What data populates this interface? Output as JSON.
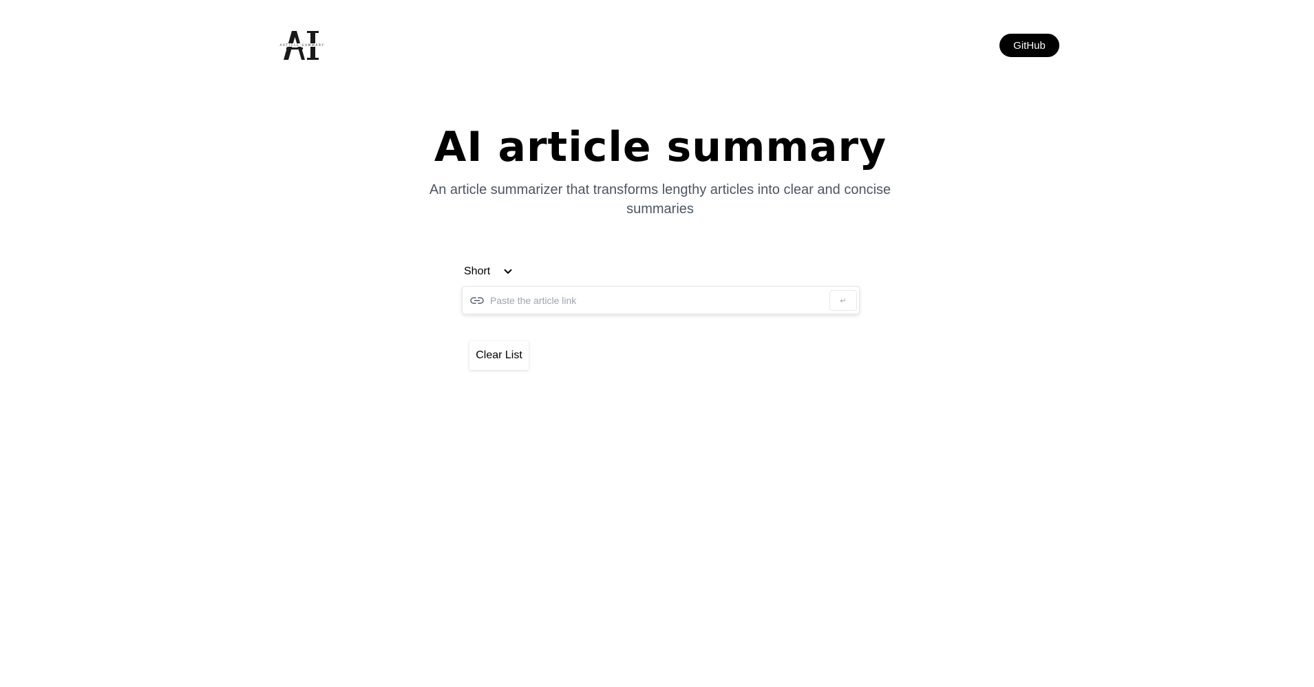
{
  "nav": {
    "logo_label": "ARTICLE SUMMARY",
    "github_label": "GitHub"
  },
  "hero": {
    "title": "AI article summary",
    "description": "An article summarizer that transforms lengthy articles into clear and concise summaries"
  },
  "length_select": {
    "selected": "Short"
  },
  "url_form": {
    "placeholder": "Paste the article link",
    "value": "",
    "submit_glyph": "↵",
    "icon": "link-icon"
  },
  "clear_list": {
    "label": "Clear List"
  },
  "colors": {
    "github_bg": "#000000",
    "description": "#4b5563",
    "placeholder": "#9ca3af"
  }
}
